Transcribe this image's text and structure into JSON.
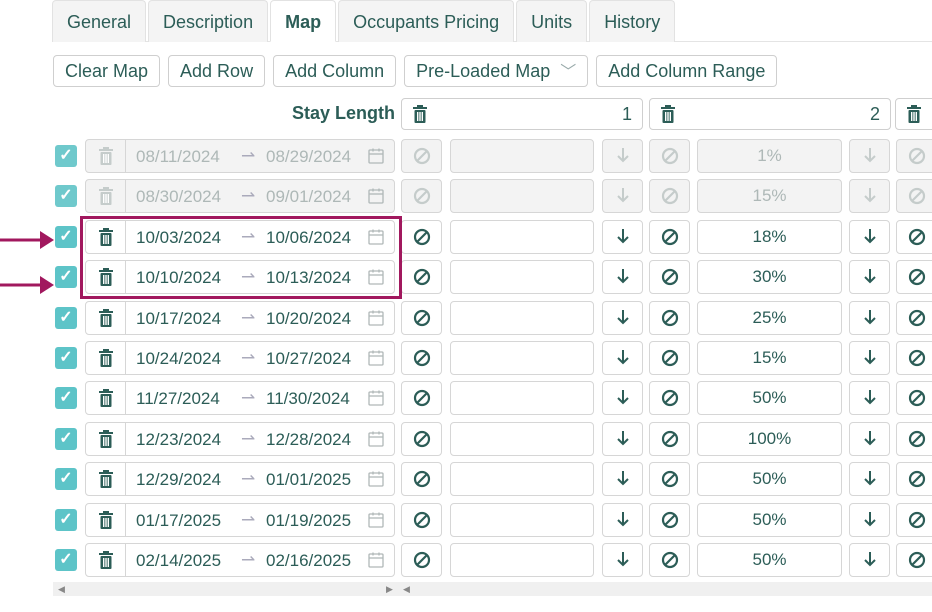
{
  "tabs": [
    {
      "label": "General",
      "active": false
    },
    {
      "label": "Description",
      "active": false
    },
    {
      "label": "Map",
      "active": true
    },
    {
      "label": "Occupants Pricing",
      "active": false
    },
    {
      "label": "Units",
      "active": false
    },
    {
      "label": "History",
      "active": false
    }
  ],
  "toolbar": {
    "clear_map": "Clear Map",
    "add_row": "Add Row",
    "add_column": "Add Column",
    "preloaded_map": "Pre-Loaded Map",
    "add_column_range": "Add Column Range"
  },
  "grid": {
    "stay_length_label": "Stay Length",
    "columns": [
      {
        "number": "1"
      },
      {
        "number": "2"
      }
    ],
    "rows": [
      {
        "start": "08/11/2024",
        "end": "08/29/2024",
        "col2": "1%",
        "disabled": true
      },
      {
        "start": "08/30/2024",
        "end": "09/01/2024",
        "col2": "15%",
        "disabled": true
      },
      {
        "start": "10/03/2024",
        "end": "10/06/2024",
        "col2": "18%",
        "disabled": false
      },
      {
        "start": "10/10/2024",
        "end": "10/13/2024",
        "col2": "30%",
        "disabled": false
      },
      {
        "start": "10/17/2024",
        "end": "10/20/2024",
        "col2": "25%",
        "disabled": false
      },
      {
        "start": "10/24/2024",
        "end": "10/27/2024",
        "col2": "15%",
        "disabled": false
      },
      {
        "start": "11/27/2024",
        "end": "11/30/2024",
        "col2": "50%",
        "disabled": false
      },
      {
        "start": "12/23/2024",
        "end": "12/28/2024",
        "col2": "100%",
        "disabled": false
      },
      {
        "start": "12/29/2024",
        "end": "01/01/2025",
        "col2": "50%",
        "disabled": false
      },
      {
        "start": "01/17/2025",
        "end": "01/19/2025",
        "col2": "50%",
        "disabled": false
      },
      {
        "start": "02/14/2025",
        "end": "02/16/2025",
        "col2": "50%",
        "disabled": false
      }
    ]
  },
  "colors": {
    "accent": "#2c5d57",
    "checkbox": "#5dc4c8",
    "highlight": "#a1185e"
  },
  "icons": [
    "trash-icon",
    "calendar-icon",
    "block-icon",
    "arrow-down-icon",
    "check-icon",
    "chevron-down-icon"
  ]
}
